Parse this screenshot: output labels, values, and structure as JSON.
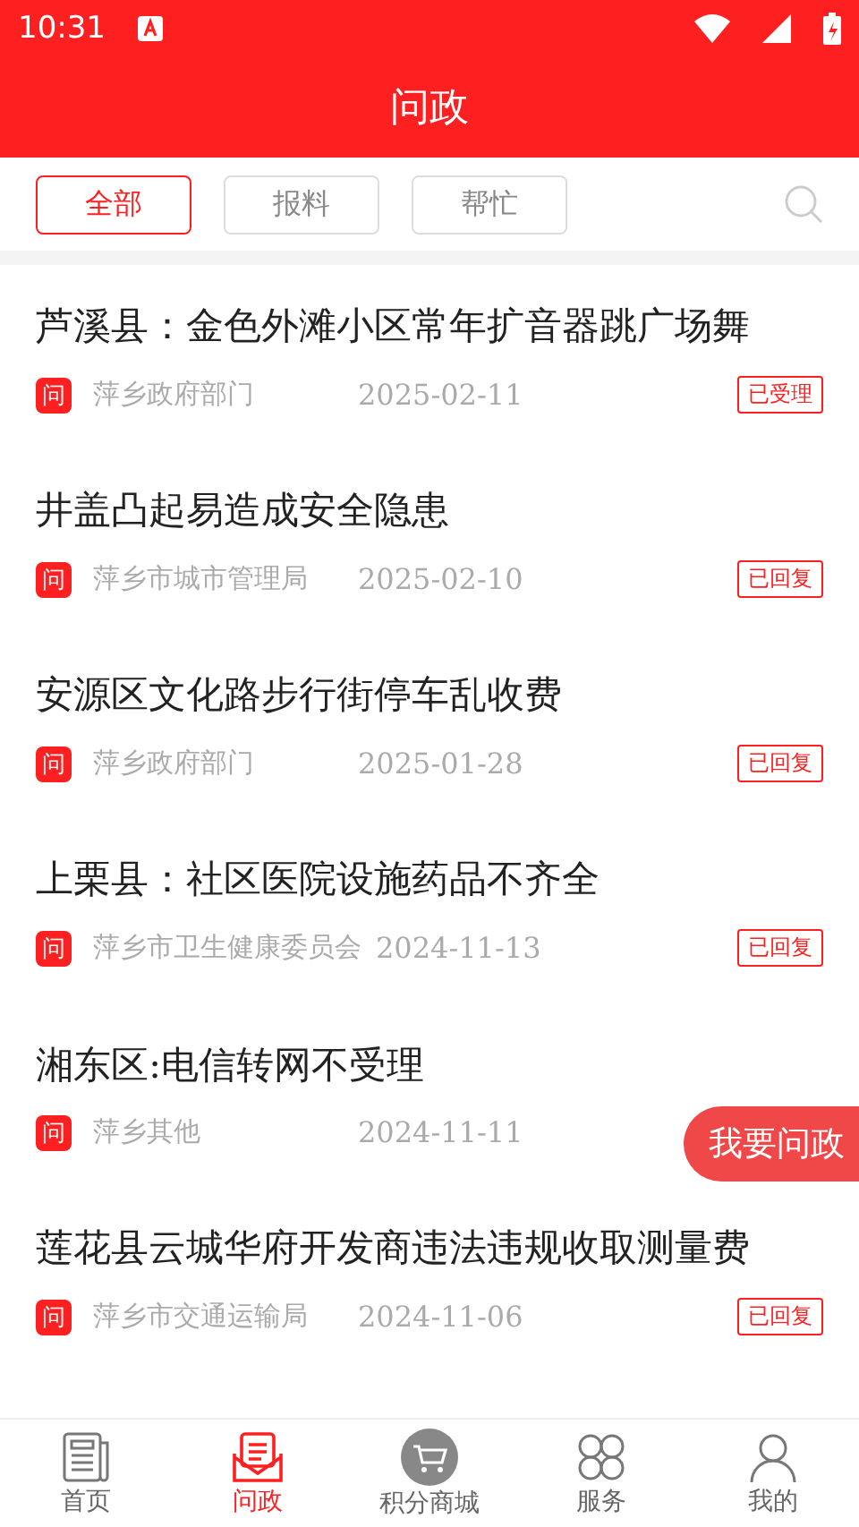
{
  "status_bar": {
    "time": "10:31"
  },
  "header": {
    "title": "问政"
  },
  "filters": [
    {
      "label": "全部",
      "selected": true
    },
    {
      "label": "报料",
      "selected": false
    },
    {
      "label": "帮忙",
      "selected": false
    }
  ],
  "items": [
    {
      "title": "芦溪县：金色外滩小区常年扩音器跳广场舞",
      "badge": "问",
      "department": "萍乡政府部门",
      "date": "2025-02-11",
      "status": "已受理"
    },
    {
      "title": "井盖凸起易造成安全隐患",
      "badge": "问",
      "department": "萍乡市城市管理局",
      "date": "2025-02-10",
      "status": "已回复"
    },
    {
      "title": "安源区文化路步行街停车乱收费",
      "badge": "问",
      "department": "萍乡政府部门",
      "date": "2025-01-28",
      "status": "已回复"
    },
    {
      "title": "上栗县：社区医院设施药品不齐全",
      "badge": "问",
      "department": "萍乡市卫生健康委员会",
      "date": "2024-11-13",
      "status": "已回复"
    },
    {
      "title": "湘东区:电信转网不受理",
      "badge": "问",
      "department": "萍乡其他",
      "date": "2024-11-11"
    },
    {
      "title": "莲花县云城华府开发商违法违规收取测量费",
      "badge": "问",
      "department": "萍乡市交通运输局",
      "date": "2024-11-06",
      "status": "已回复"
    }
  ],
  "float_button": {
    "label": "我要问政"
  },
  "nav": [
    {
      "label": "首页",
      "selected": false
    },
    {
      "label": "问政",
      "selected": true
    },
    {
      "label": "积分商城",
      "selected": false
    },
    {
      "label": "服务",
      "selected": false
    },
    {
      "label": "我的",
      "selected": false
    }
  ]
}
